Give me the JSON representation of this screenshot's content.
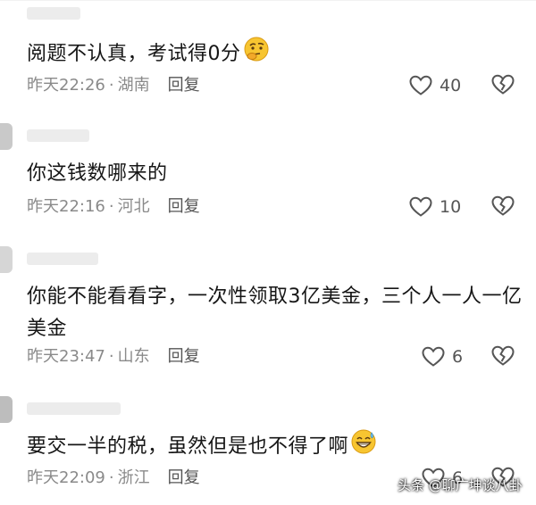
{
  "comments": [
    {
      "text": "阅题不认真，考试得0分",
      "emoji": "thinking-emoji",
      "time": "昨天22:26",
      "sep": "·",
      "location": "湖南",
      "reply_label": "回复",
      "likes": "40"
    },
    {
      "text": "你这钱数哪来的",
      "emoji": "",
      "time": "昨天22:16",
      "sep": "·",
      "location": "河北",
      "reply_label": "回复",
      "likes": "10"
    },
    {
      "text": "你能不能看看字，一次性领取3亿美金，三个人一人一亿美金",
      "emoji": "",
      "time": "昨天23:47",
      "sep": "·",
      "location": "山东",
      "reply_label": "回复",
      "likes": "6"
    },
    {
      "text": "要交一半的税，虽然但是也不得了啊",
      "emoji": "grin-sweat-emoji",
      "time": "昨天22:09",
      "sep": "·",
      "location": "浙江",
      "reply_label": "回复",
      "likes": "6"
    }
  ],
  "watermark": "头条 @聊广坤谈八卦",
  "colors": {
    "text": "#161616",
    "meta": "#8a8a8a",
    "icon": "#555555"
  }
}
